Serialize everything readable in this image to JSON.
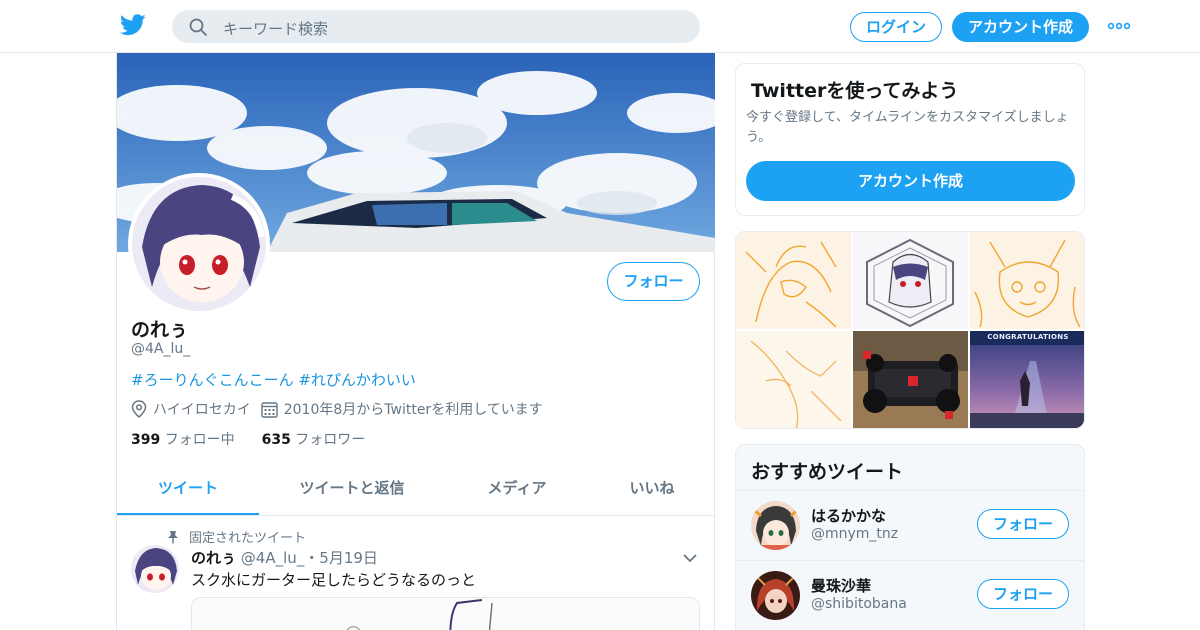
{
  "colors": {
    "accent": "#1da1f2",
    "link": "#1b95e0",
    "text": "#14171a",
    "muted": "#657786",
    "border": "#e1e8ed"
  },
  "topbar": {
    "logo_icon": "twitter-bird-icon",
    "search_placeholder": "キーワード検索",
    "login_label": "ログイン",
    "signup_label": "アカウント作成",
    "more_icon": "more-dots-icon"
  },
  "profile": {
    "follow_label": "フォロー",
    "name": "のれぅ",
    "handle": "@4A_lu_",
    "bio": "#ろーりんぐこんこーん #れぴんかわいい",
    "location_icon": "location-pin-icon",
    "location": "ハイイロセカイ",
    "joined_icon": "calendar-icon",
    "joined": "2010年8月からTwitterを利用しています",
    "following_count": "399",
    "following_label": "フォロー中",
    "followers_count": "635",
    "followers_label": "フォロワー"
  },
  "tabs": [
    "ツイート",
    "ツイートと返信",
    "メディア",
    "いいね"
  ],
  "tweet": {
    "pinned_label": "固定されたツイート",
    "name": "のれぅ",
    "handle": "@4A_lu_",
    "separator": "・",
    "date": "5月19日",
    "text": "スク水にガーター足したらどうなるのっと"
  },
  "signup_card": {
    "title": "Twitterを使ってみよう",
    "description": "今すぐ登録して、タイムラインをカスタマイズしましょう。",
    "button": "アカウント作成"
  },
  "gallery": {
    "caption": "CONGRATULATIONS"
  },
  "recommendations": {
    "title": "おすすめツイート",
    "items": [
      {
        "name": "はるかかな",
        "handle": "@mnym_tnz",
        "follow_label": "フォロー"
      },
      {
        "name": "曼珠沙華",
        "handle": "@shibitobana",
        "follow_label": "フォロー"
      }
    ]
  }
}
